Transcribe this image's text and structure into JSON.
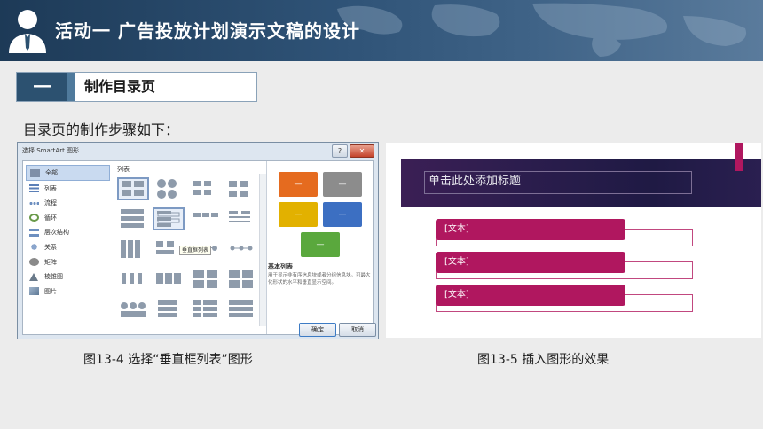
{
  "header": {
    "title": "活动一  广告投放计划演示文稿的设计"
  },
  "section": {
    "number": "一",
    "label": "制作目录页"
  },
  "intro": "目录页的制作步骤如下：",
  "dialog": {
    "title": "选择 SmartArt 图形",
    "help": "?",
    "close": "✕",
    "categories": [
      "全部",
      "列表",
      "流程",
      "循环",
      "层次结构",
      "关系",
      "矩阵",
      "棱锥图",
      "图片"
    ],
    "gallery_label": "列表",
    "tooltip": "垂直框列表",
    "preview_title": "基本列表",
    "preview_desc": "用于显示非有序信息块或者分组信息块。可最大化形状的水平和垂直显示空间。",
    "preview_box_text": "—",
    "ok": "确定",
    "cancel": "取消",
    "preview_colors": [
      "#e56b1f",
      "#8c8c8c",
      "#e2b100",
      "#3c6fc2",
      "#5aa83d"
    ]
  },
  "slide": {
    "title_placeholder": "单击此处添加标题",
    "items": [
      "[文本]",
      "[文本]",
      "[文本]"
    ],
    "accent": "#b0175f"
  },
  "captions": {
    "left": "图13-4  选择“垂直框列表”图形",
    "right": "图13-5  插入图形的效果"
  }
}
